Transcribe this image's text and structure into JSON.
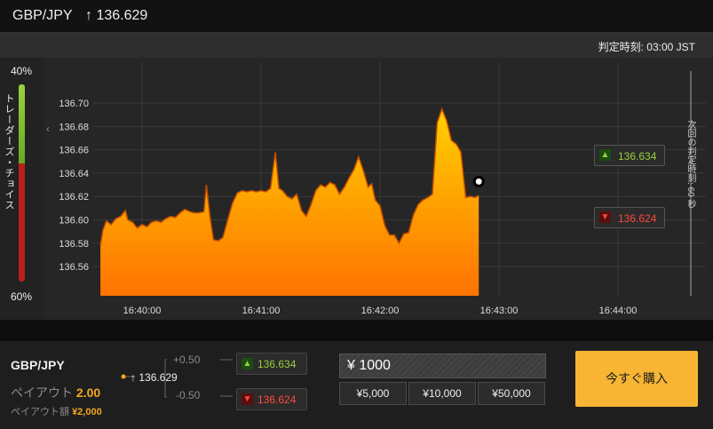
{
  "header": {
    "pair": "GBP/JPY",
    "rate": "↑ 136.629"
  },
  "subbar": {
    "expiry": "判定時刻:  03:00 JST"
  },
  "sentiment": {
    "top_pct": "40%",
    "bottom_pct": "60%",
    "label": "トレーダーズ・チョイス",
    "up_fraction": 0.4
  },
  "side_label": "次回の判定時刻: 60 秒",
  "chart_data": {
    "type": "area",
    "y_ticks": [
      "136.70",
      "136.68",
      "136.66",
      "136.64",
      "136.62",
      "136.60",
      "136.58",
      "136.56"
    ],
    "x_ticks": [
      "16:40:00",
      "16:41:00",
      "16:42:00",
      "16:43:00",
      "16:44:00"
    ],
    "ylim": [
      136.535,
      136.735
    ],
    "x_minutes": [
      -0.35,
      1.75
    ],
    "series": [
      {
        "values": [
          [
            -0.35,
            136.578
          ],
          [
            -0.33,
            136.591
          ],
          [
            -0.3,
            136.599
          ],
          [
            -0.26,
            136.596
          ],
          [
            -0.22,
            136.601
          ],
          [
            -0.18,
            136.603
          ],
          [
            -0.14,
            136.608
          ],
          [
            -0.12,
            136.6
          ],
          [
            -0.08,
            136.598
          ],
          [
            -0.04,
            136.593
          ],
          [
            0.0,
            136.596
          ],
          [
            0.04,
            136.594
          ],
          [
            0.08,
            136.598
          ],
          [
            0.12,
            136.599
          ],
          [
            0.16,
            136.598
          ],
          [
            0.2,
            136.601
          ],
          [
            0.24,
            136.603
          ],
          [
            0.28,
            136.602
          ],
          [
            0.32,
            136.606
          ],
          [
            0.36,
            136.609
          ],
          [
            0.4,
            136.607
          ],
          [
            0.44,
            136.606
          ],
          [
            0.48,
            136.606
          ],
          [
            0.52,
            136.607
          ],
          [
            0.54,
            136.63
          ],
          [
            0.57,
            136.603
          ],
          [
            0.6,
            136.583
          ],
          [
            0.64,
            136.582
          ],
          [
            0.68,
            136.585
          ],
          [
            0.72,
            136.6
          ],
          [
            0.76,
            136.614
          ],
          [
            0.8,
            136.623
          ],
          [
            0.84,
            136.625
          ],
          [
            0.88,
            136.624
          ],
          [
            0.92,
            136.625
          ],
          [
            0.96,
            136.624
          ],
          [
            1.0,
            136.625
          ],
          [
            1.04,
            136.624
          ],
          [
            1.08,
            136.627
          ],
          [
            1.12,
            136.658
          ],
          [
            1.15,
            136.627
          ],
          [
            1.18,
            136.625
          ],
          [
            1.22,
            136.62
          ],
          [
            1.26,
            136.618
          ],
          [
            1.3,
            136.622
          ],
          [
            1.34,
            136.608
          ],
          [
            1.38,
            136.603
          ],
          [
            1.42,
            136.613
          ],
          [
            1.46,
            136.625
          ],
          [
            1.5,
            136.63
          ],
          [
            1.54,
            136.628
          ],
          [
            1.58,
            136.632
          ],
          [
            1.62,
            136.63
          ],
          [
            1.66,
            136.622
          ],
          [
            1.7,
            136.628
          ],
          [
            1.74,
            136.636
          ],
          [
            1.78,
            136.643
          ],
          [
            1.82,
            136.654
          ],
          [
            1.86,
            136.642
          ],
          [
            1.9,
            136.628
          ],
          [
            1.93,
            136.631
          ],
          [
            1.96,
            136.617
          ],
          [
            2.0,
            136.612
          ],
          [
            2.04,
            136.595
          ],
          [
            2.08,
            136.587
          ],
          [
            2.12,
            136.587
          ],
          [
            2.16,
            136.58
          ],
          [
            2.2,
            136.588
          ],
          [
            2.24,
            136.589
          ],
          [
            2.28,
            136.604
          ],
          [
            2.32,
            136.613
          ],
          [
            2.36,
            136.617
          ],
          [
            2.4,
            136.619
          ],
          [
            2.44,
            136.622
          ],
          [
            2.48,
            136.683
          ],
          [
            2.52,
            136.695
          ],
          [
            2.56,
            136.685
          ],
          [
            2.6,
            136.668
          ],
          [
            2.64,
            136.665
          ],
          [
            2.68,
            136.658
          ],
          [
            2.72,
            136.619
          ],
          [
            2.76,
            136.62
          ],
          [
            2.8,
            136.619
          ],
          [
            2.83,
            136.621
          ]
        ]
      }
    ],
    "current_price": [
      2.83,
      136.629
    ]
  },
  "chart_buttons": {
    "up": "136.634",
    "down": "136.624"
  },
  "bottom": {
    "pair": "GBP/JPY",
    "payout_label": "ペイアウト",
    "payout_value": "2.00",
    "amount_label": "ペイアウト額",
    "amount_value": "¥2,000",
    "rate": "136.629",
    "plus": "+0.50",
    "minus": "-0.50",
    "up_rate": "136.634",
    "down_rate": "136.624",
    "investment": "¥ 1000",
    "presets": [
      "¥5,000",
      "¥10,000",
      "¥50,000"
    ],
    "buy_label": "今すぐ購入"
  },
  "icons": {
    "up": "arrow-up-icon",
    "down": "arrow-down-icon",
    "collapse": "chevron-left-icon",
    "point": "current-price-marker"
  },
  "colors": {
    "area_top": "#ffd200",
    "area_bottom": "#ff7a00",
    "line": "#c44d00",
    "accent": "#f7b533",
    "up": "#9ad03c",
    "down": "#ff4a3a"
  }
}
